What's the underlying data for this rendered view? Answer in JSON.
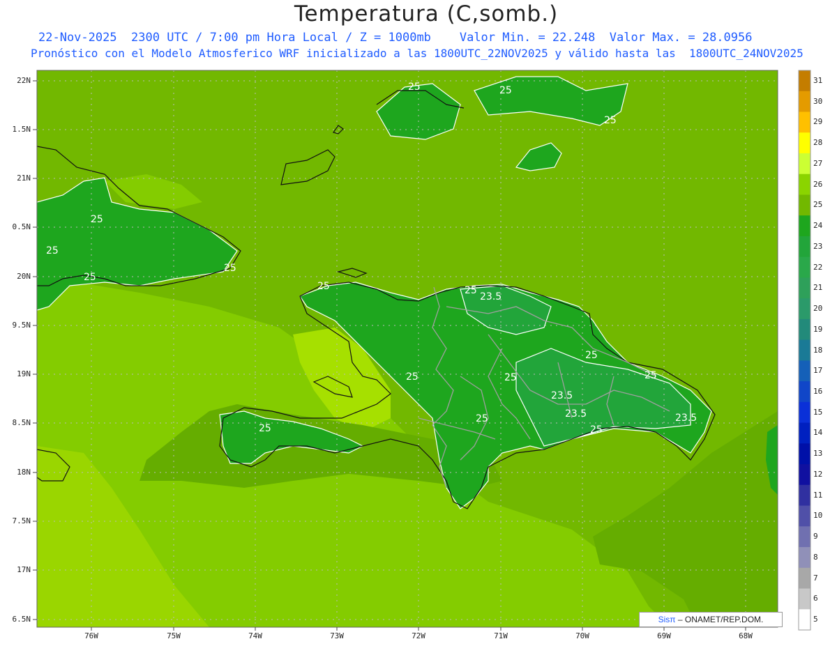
{
  "header": {
    "title": "Temperatura (C,somb.)",
    "line1": "22-Nov-2025  2300 UTC / 7:00 pm Hora Local / Z = 1000mb    Valor Min. = 22.248  Valor Max. = 28.0956",
    "line2": "Pronóstico con el Modelo Atmosferico WRF inicializado a las 1800UTC_22NOV2025 y válido hasta las  1800UTC_24NOV2025"
  },
  "axes": {
    "lat_labels": [
      "22N",
      "1.5N",
      "21N",
      "0.5N",
      "20N",
      "9.5N",
      "19N",
      "8.5N",
      "18N",
      "7.5N",
      "17N",
      "6.5N"
    ],
    "lon_labels": [
      "76W",
      "75W",
      "74W",
      "73W",
      "72W",
      "71W",
      "70W",
      "69W",
      "68W"
    ]
  },
  "colorbar": {
    "labels": [
      "31",
      "30",
      "29",
      "28",
      "27",
      "26",
      "25",
      "24",
      "23",
      "22",
      "21",
      "20",
      "19",
      "18",
      "17",
      "16",
      "15",
      "14",
      "13",
      "12",
      "11",
      "10",
      "9",
      "8",
      "7",
      "6",
      "5"
    ],
    "colors": [
      "#c47d00",
      "#e49b00",
      "#ffc000",
      "#ffff00",
      "#ccff33",
      "#8bd400",
      "#72b800",
      "#1ea61e",
      "#22a53a",
      "#2aa84a",
      "#2ea05a",
      "#2b9a6a",
      "#228a7a",
      "#1a7a96",
      "#1560b8",
      "#1046c8",
      "#0a30d8",
      "#0020c0",
      "#0010a8",
      "#1010a0",
      "#3030a0",
      "#5050a8",
      "#7070b0",
      "#9090b8",
      "#a8a8a8",
      "#c8c8c8",
      "#ffffff"
    ]
  },
  "contour_labels": [
    "25",
    "25",
    "25",
    "25",
    "25",
    "25",
    "25",
    "25",
    "25",
    "25",
    "25",
    "25",
    "23.5",
    "25",
    "23.5",
    "23.5",
    "25",
    "25",
    "23.5",
    "25"
  ],
  "credit": {
    "sis": "Sisπ",
    "rest": "– ONAMET/REP.DOM."
  }
}
